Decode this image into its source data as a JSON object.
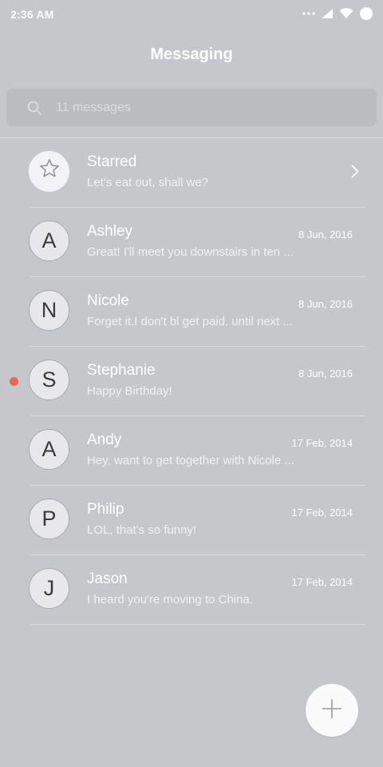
{
  "status_bar": {
    "time": "2:36 AM",
    "icons": [
      "more-dots-icon",
      "signal-icon",
      "wifi-icon",
      "battery-icon"
    ]
  },
  "header": {
    "title": "Messaging"
  },
  "search": {
    "placeholder": "11 messages",
    "icon": "search-icon"
  },
  "conversations": [
    {
      "avatar": "star-icon",
      "name": "Starred",
      "preview": "Let's eat out, shall we?",
      "date": "",
      "unread": false
    },
    {
      "avatar": "A",
      "name": "Ashley",
      "preview": "Great! I'll meet you downstairs in ten ...",
      "date": "8 Jun, 2016",
      "unread": false
    },
    {
      "avatar": "N",
      "name": "Nicole",
      "preview": "Forget it.I don't bl get paid. until next ...",
      "date": "8 Jun, 2016",
      "unread": false
    },
    {
      "avatar": "S",
      "name": "Stephanie",
      "preview": "Happy Birthday!",
      "date": "8 Jun, 2016",
      "unread": true
    },
    {
      "avatar": "A",
      "name": "Andy",
      "preview": "Hey, want to get together with Nicole ...",
      "date": "17 Feb, 2014",
      "unread": false
    },
    {
      "avatar": "P",
      "name": "Philip",
      "preview": "LOL, that's so funny!",
      "date": "17 Feb, 2014",
      "unread": false
    },
    {
      "avatar": "J",
      "name": "Jason",
      "preview": "I heard you're moving to China.",
      "date": "17 Feb, 2014",
      "unread": false
    }
  ],
  "fab": {
    "icon": "plus-icon"
  },
  "colors": {
    "background": "#c6c7cb",
    "search_bg": "#bbbcc0",
    "unread_dot": "#e36b4f",
    "text": "#ffffff"
  }
}
